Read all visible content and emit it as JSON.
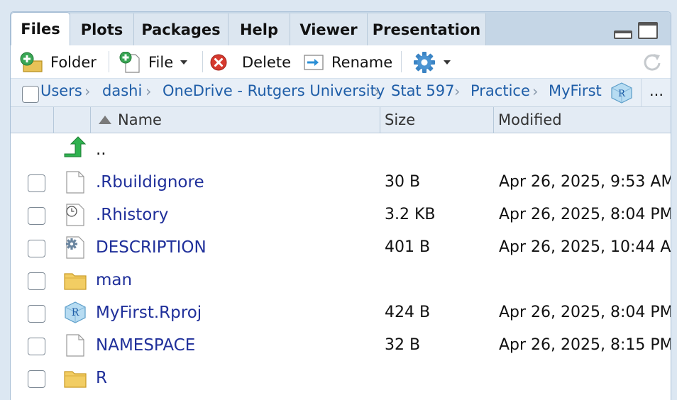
{
  "tabs": [
    {
      "label": "Files",
      "active": true
    },
    {
      "label": "Plots"
    },
    {
      "label": "Packages"
    },
    {
      "label": "Help"
    },
    {
      "label": "Viewer"
    },
    {
      "label": "Presentation"
    }
  ],
  "toolbar": {
    "new_folder": "Folder",
    "new_file": "File",
    "delete": "Delete",
    "rename": "Rename"
  },
  "breadcrumb": [
    "Users",
    "dashi",
    "OneDrive - Rutgers University",
    "Stat 597",
    "Practice",
    "MyFirst"
  ],
  "breadcrumb_more": "...",
  "columns": {
    "name": "Name",
    "size": "Size",
    "modified": "Modified"
  },
  "parent_link": "..",
  "files": [
    {
      "name": ".Rbuildignore",
      "size": "30 B",
      "modified": "Apr 26, 2025, 9:53 AM",
      "icon": "file-icon"
    },
    {
      "name": ".Rhistory",
      "size": "3.2 KB",
      "modified": "Apr 26, 2025, 8:04 PM",
      "icon": "history-file-icon"
    },
    {
      "name": "DESCRIPTION",
      "size": "401 B",
      "modified": "Apr 26, 2025, 10:44 AM",
      "icon": "settings-file-icon"
    },
    {
      "name": "man",
      "size": "",
      "modified": "",
      "icon": "folder-icon"
    },
    {
      "name": "MyFirst.Rproj",
      "size": "424 B",
      "modified": "Apr 26, 2025, 8:04 PM",
      "icon": "rproj-icon"
    },
    {
      "name": "NAMESPACE",
      "size": "32 B",
      "modified": "Apr 26, 2025, 8:15 PM",
      "icon": "file-icon"
    },
    {
      "name": "R",
      "size": "",
      "modified": "",
      "icon": "folder-icon"
    }
  ],
  "colors": {
    "link": "#1f2f9a",
    "crumb": "#1f5ea8",
    "header_bg": "#e3ebf4",
    "tab_bg": "#c5d6e6"
  }
}
